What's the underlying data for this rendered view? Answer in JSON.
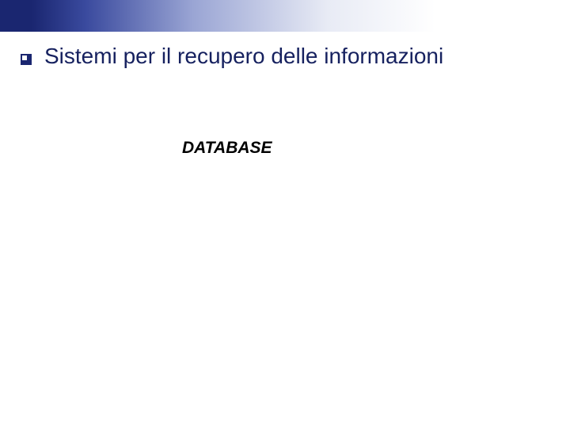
{
  "slide": {
    "title": "Sistemi per il recupero delle informazioni",
    "subtitle": "DATABASE"
  },
  "colors": {
    "accent": "#1a2670",
    "title_color": "#16215f"
  }
}
